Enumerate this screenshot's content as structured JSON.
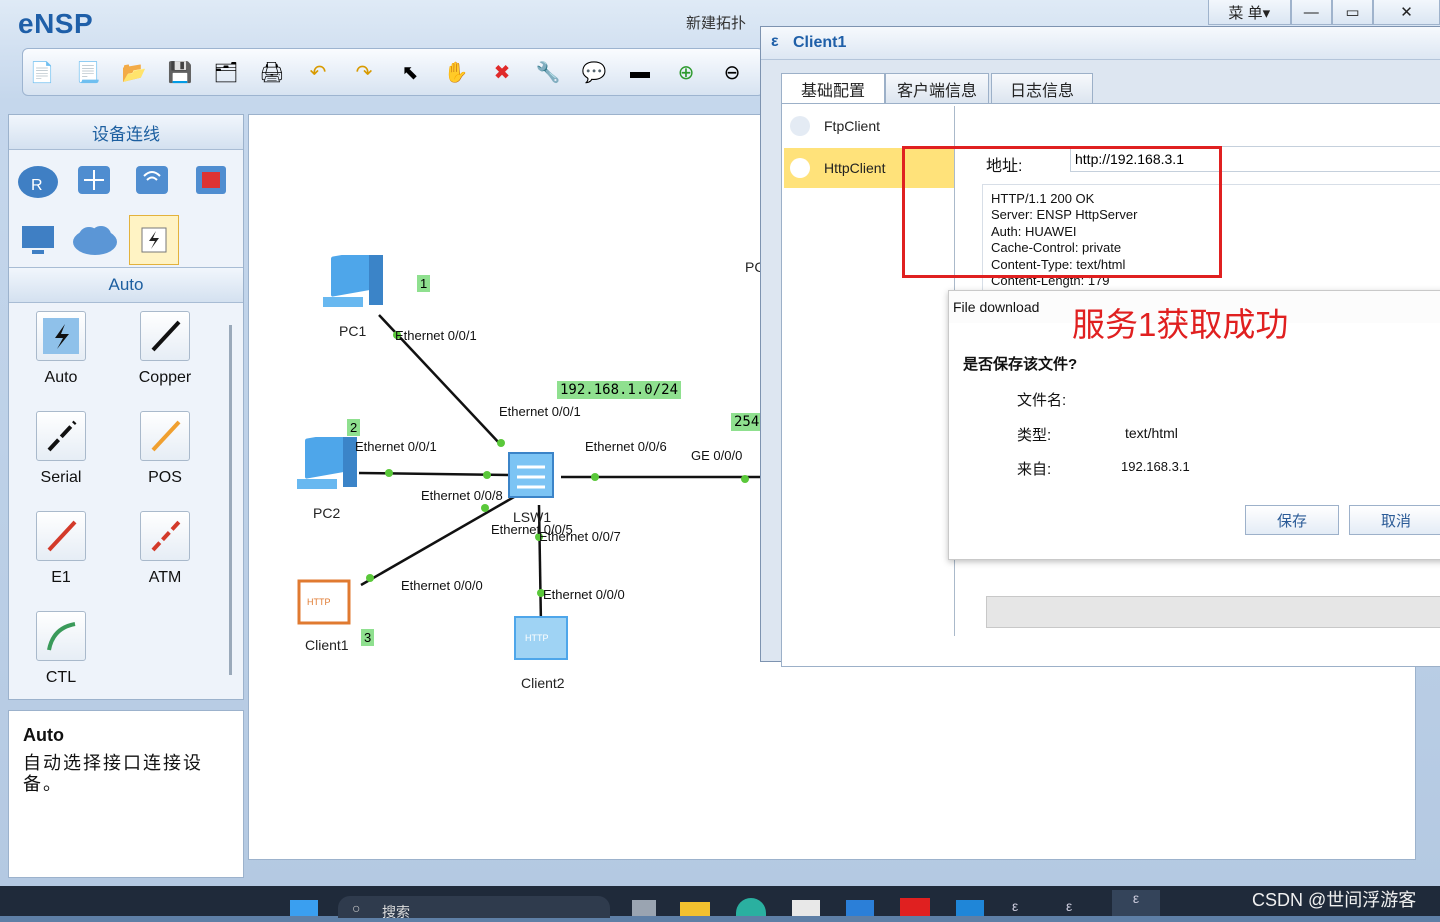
{
  "app": {
    "name": "eNSP",
    "title": "新建拓扑",
    "menu_label": "菜 单▾"
  },
  "toolbar_icons": [
    "new-topology-icon",
    "new-test-icon",
    "open-icon",
    "save-icon",
    "save-as-icon",
    "print-icon",
    "undo-icon",
    "redo-icon",
    "select-icon",
    "pan-icon",
    "delete-icon",
    "delete-link-icon",
    "text-icon",
    "palette-icon",
    "zoom-in-icon",
    "zoom-out-icon"
  ],
  "left_panel": {
    "header": "设备连线",
    "category_label": "Auto",
    "cables": [
      {
        "label": "Auto"
      },
      {
        "label": "Copper"
      },
      {
        "label": "Serial"
      },
      {
        "label": "POS"
      },
      {
        "label": "E1"
      },
      {
        "label": "ATM"
      },
      {
        "label": "CTL"
      }
    ]
  },
  "description": {
    "title": "Auto",
    "text": "自动选择接口连接设备。"
  },
  "topology": {
    "nodes": {
      "pc1": "PC1",
      "pc2": "PC2",
      "lsw1": "LSW1",
      "client1": "Client1",
      "client2": "Client2",
      "server_partial": "PC"
    },
    "ports": {
      "pc1_eth": "Ethernet 0/0/1",
      "lsw_eth1": "Ethernet 0/0/1",
      "pc2_eth": "Ethernet 0/0/1",
      "lsw_eth6": "Ethernet 0/0/6",
      "lsw_eth8": "Ethernet 0/0/8",
      "lsw_eth5": "Ethernet 0/0/5",
      "lsw_eth7": "Ethernet 0/0/7",
      "client1_eth": "Ethernet 0/0/0",
      "client2_eth": "Ethernet 0/0/0",
      "server_ge": "GE 0/0/0"
    },
    "tags": {
      "t1": "1",
      "t2": "2",
      "t3": "3",
      "subnet": "192.168.1.0/24",
      "t254": "254"
    }
  },
  "client_window": {
    "title": "Client1",
    "tabs": [
      "基础配置",
      "客户端信息",
      "日志信息"
    ],
    "side_items": [
      "FtpClient",
      "HttpClient"
    ],
    "address_label": "地址:",
    "address_value": "http://192.168.3.1",
    "response_lines": [
      "HTTP/1.1 200 OK",
      "Server: ENSP HttpServer",
      "Auth: HUAWEI",
      "Cache-Control: private",
      "Content-Type: text/html",
      "Content-Length: 179"
    ]
  },
  "annotation": "服务1获取成功",
  "download_dialog": {
    "title": "File download",
    "question": "是否保存该文件?",
    "filename_label": "文件名:",
    "type_label": "类型:",
    "type_value": "text/html",
    "from_label": "来自:",
    "from_value": "192.168.3.1",
    "save_label": "保存",
    "cancel_label": "取消"
  },
  "taskbar": {
    "search_text": "搜索",
    "watermark": "CSDN @世间浮游客"
  },
  "colors": {
    "accent": "#1f5fa8",
    "tag_green": "#8fe08f",
    "highlight_red": "#e02020",
    "selected_yellow": "#ffe27a"
  }
}
